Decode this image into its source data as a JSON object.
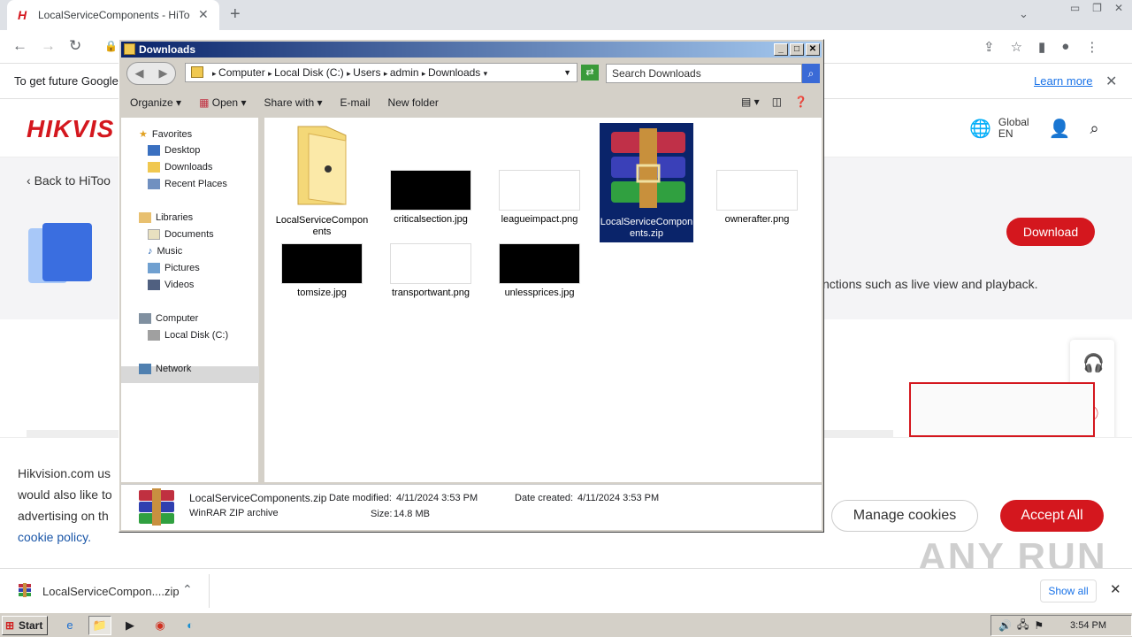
{
  "browser": {
    "tab_title": "LocalServiceComponents - HiTools - H",
    "info_text": "To get future Google",
    "learn_more": "Learn more"
  },
  "site": {
    "logo": "HIKVIS",
    "global_line1": "Global",
    "global_line2": "EN",
    "back_label": "Back to HiToo",
    "download_button": "Download",
    "description": "nctions such as live view and playback.",
    "cookie_text": "Hikvision.com us would also like to advertising on th",
    "cookie_link": "cookie policy.",
    "manage_cookies": "Manage cookies",
    "accept_all": "Accept All",
    "watermark": "ANY RUN"
  },
  "download_bar": {
    "file_name": "LocalServiceCompon....zip",
    "show_all": "Show all"
  },
  "taskbar": {
    "start": "Start",
    "clock": "3:54 PM"
  },
  "explorer": {
    "title": "Downloads",
    "breadcrumb": [
      "Computer",
      "Local Disk (C:)",
      "Users",
      "admin",
      "Downloads"
    ],
    "search_placeholder": "Search Downloads",
    "commands": {
      "organize": "Organize",
      "open": "Open",
      "share_with": "Share with",
      "email": "E-mail",
      "new_folder": "New folder"
    },
    "nav": {
      "favorites": "Favorites",
      "desktop": "Desktop",
      "downloads": "Downloads",
      "recent_places": "Recent Places",
      "libraries": "Libraries",
      "documents": "Documents",
      "music": "Music",
      "pictures": "Pictures",
      "videos": "Videos",
      "computer": "Computer",
      "local_disk": "Local Disk (C:)",
      "network": "Network"
    },
    "files": [
      {
        "name": "LocalServiceComponents",
        "kind": "folder"
      },
      {
        "name": "criticalsection.jpg",
        "kind": "black"
      },
      {
        "name": "leagueimpact.png",
        "kind": "white"
      },
      {
        "name": "LocalServiceComponents.zip",
        "kind": "zip",
        "selected": true
      },
      {
        "name": "ownerafter.png",
        "kind": "white"
      },
      {
        "name": "tomsize.jpg",
        "kind": "black"
      },
      {
        "name": "transportwant.png",
        "kind": "white"
      },
      {
        "name": "unlessprices.jpg",
        "kind": "black"
      }
    ],
    "details": {
      "name": "LocalServiceComponents.zip",
      "type": "WinRAR ZIP archive",
      "modified_label": "Date modified:",
      "modified": "4/11/2024 3:53 PM",
      "created_label": "Date created:",
      "created": "4/11/2024 3:53 PM",
      "size_label": "Size:",
      "size": "14.8 MB"
    }
  }
}
